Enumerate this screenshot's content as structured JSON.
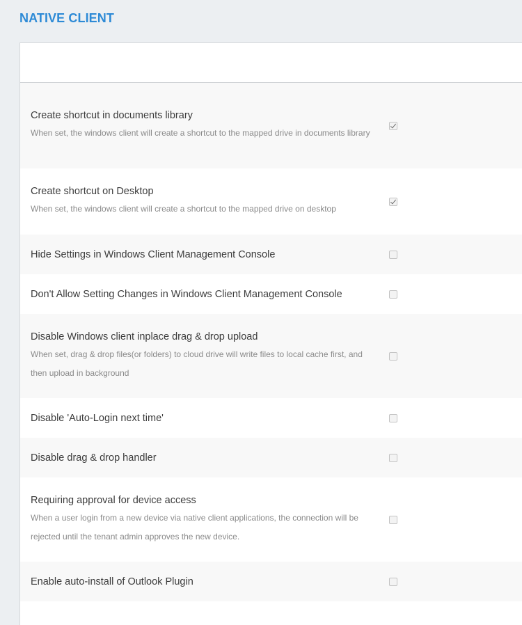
{
  "page": {
    "title": "NATIVE CLIENT"
  },
  "settings": [
    {
      "title": "Create shortcut in documents library",
      "desc": "When set, the windows client will create a shortcut to the mapped drive in documents library",
      "checked": true
    },
    {
      "title": "Create shortcut on Desktop",
      "desc": "When set, the windows client will create a shortcut to the mapped drive on desktop",
      "checked": true
    },
    {
      "title": "Hide Settings in Windows Client Management Console",
      "desc": "",
      "checked": false
    },
    {
      "title": "Don't Allow Setting Changes in Windows Client Management Console",
      "desc": "",
      "checked": false
    },
    {
      "title": "Disable Windows client inplace drag & drop upload",
      "desc": "When set, drag & drop files(or folders) to cloud drive will write files to local cache first, and then upload in background",
      "checked": false
    },
    {
      "title": "Disable 'Auto-Login next time'",
      "desc": "",
      "checked": false
    },
    {
      "title": "Disable drag & drop handler",
      "desc": "",
      "checked": false
    },
    {
      "title": "Requiring approval for device access",
      "desc": "When a user login from a new device via native client applications, the connection will be rejected until the tenant admin approves the new device.",
      "checked": false
    },
    {
      "title": "Enable auto-install of Outlook Plugin",
      "desc": "",
      "checked": false
    }
  ]
}
